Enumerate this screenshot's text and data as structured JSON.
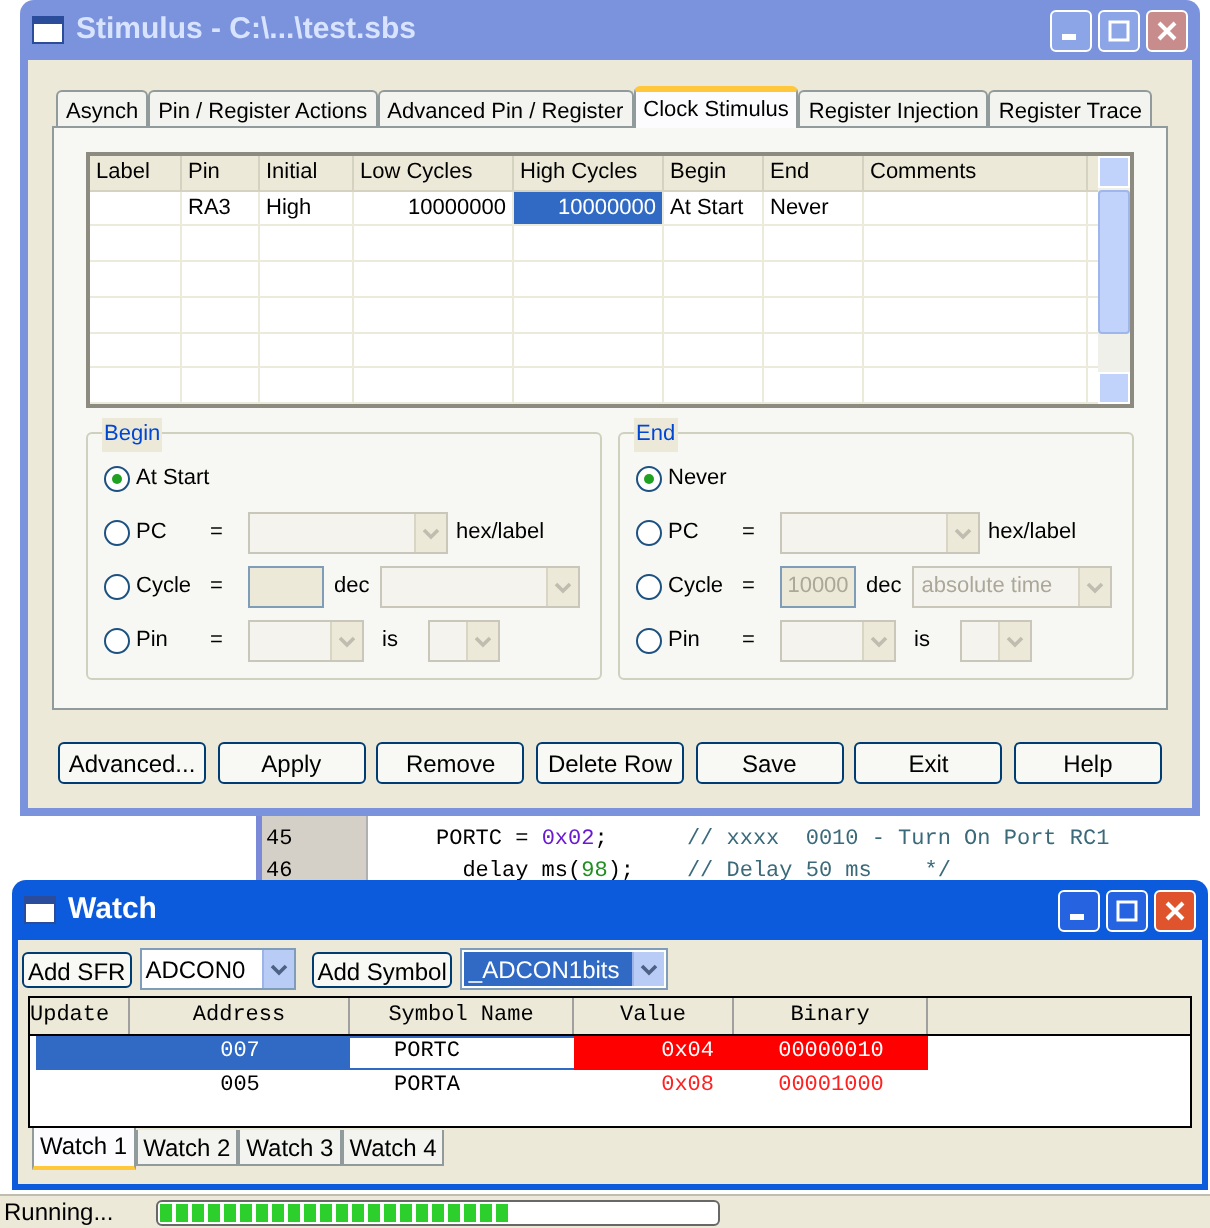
{
  "stimulus": {
    "title": "Stimulus - C:\\...\\test.sbs",
    "tabs": [
      {
        "label": "Asynch",
        "selected": false
      },
      {
        "label": "Pin / Register Actions",
        "selected": false
      },
      {
        "label": "Advanced Pin / Register",
        "selected": false
      },
      {
        "label": "Clock Stimulus",
        "selected": true
      },
      {
        "label": "Register Injection",
        "selected": false
      },
      {
        "label": "Register Trace",
        "selected": false
      }
    ],
    "table": {
      "columns": [
        "Label",
        "Pin",
        "Initial",
        "Low Cycles",
        "High Cycles",
        "Begin",
        "End",
        "Comments"
      ],
      "rows": [
        {
          "cells": [
            {
              "selected": false
            },
            {
              "text": "RA3",
              "selected": false
            },
            {
              "text": "High",
              "selected": false
            },
            {
              "text": "10000000",
              "selected": false
            },
            {
              "text": "10000000",
              "selected": true
            },
            {
              "text": "At Start",
              "selected": false
            },
            {
              "text": "Never",
              "selected": false
            },
            {
              "selected": false
            }
          ]
        }
      ]
    },
    "begin": {
      "title": "Begin",
      "options": [
        {
          "label": "At Start",
          "kind": "plain",
          "selected": true
        },
        {
          "label": "PC",
          "kind": "address",
          "equals": "=",
          "unit": "hex/label",
          "selected": false
        },
        {
          "label": "Cycle",
          "kind": "cycle",
          "equals": "=",
          "unit": "dec",
          "selected": false
        },
        {
          "label": "Pin",
          "kind": "pin",
          "equals": "=",
          "unit": "is",
          "selected": false
        }
      ]
    },
    "end": {
      "title": "End",
      "options": [
        {
          "label": "Never",
          "kind": "plain",
          "selected": true
        },
        {
          "label": "PC",
          "kind": "address",
          "equals": "=",
          "unit": "hex/label",
          "selected": false
        },
        {
          "label": "Cycle",
          "kind": "cycle",
          "equals": "=",
          "unit": "dec",
          "value": "10000",
          "mode": "absolute time",
          "selected": false
        },
        {
          "label": "Pin",
          "kind": "pin",
          "equals": "=",
          "unit": "is",
          "selected": false
        }
      ]
    },
    "buttons": [
      "Advanced...",
      "Apply",
      "Remove",
      "Delete Row",
      "Save",
      "Exit",
      "Help"
    ]
  },
  "editor": {
    "lines": [
      {
        "number": "45",
        "segments": [
          {
            "kind": "code",
            "text": "PORTC = "
          },
          {
            "kind": "hex",
            "text": "0x02"
          },
          {
            "kind": "code",
            "text": ";      "
          },
          {
            "kind": "comment",
            "text": "// xxxx  0010 - Turn On Port RC1"
          }
        ]
      },
      {
        "number": "46",
        "segments": [
          {
            "kind": "code",
            "text": "  delay ms("
          },
          {
            "kind": "num",
            "text": "98"
          },
          {
            "kind": "code",
            "text": ");    "
          },
          {
            "kind": "comment",
            "text": "// Delay 50 ms    */"
          }
        ]
      }
    ]
  },
  "watch": {
    "title": "Watch",
    "add_sfr": "Add SFR",
    "sfr": "ADCON0",
    "add_symbol": "Add Symbol",
    "symbol": "_ADCON1bits",
    "columns": [
      "Update",
      "Address",
      "Symbol Name",
      "Value",
      "Binary"
    ],
    "rows": [
      {
        "address": "007",
        "symbol": "PORTC",
        "value": "0x04",
        "binary": "00000010",
        "selected": true,
        "changed": true
      },
      {
        "address": "005",
        "symbol": "PORTA",
        "value": "0x08",
        "binary": "00001000",
        "selected": false,
        "changed": true
      }
    ],
    "tabs": [
      {
        "label": "Watch 1",
        "selected": true
      },
      {
        "label": "Watch 2",
        "selected": false
      },
      {
        "label": "Watch 3",
        "selected": false
      },
      {
        "label": "Watch 4",
        "selected": false
      }
    ]
  },
  "status_bar": {
    "text": "Running...",
    "progress": {
      "level": 0.63
    }
  }
}
